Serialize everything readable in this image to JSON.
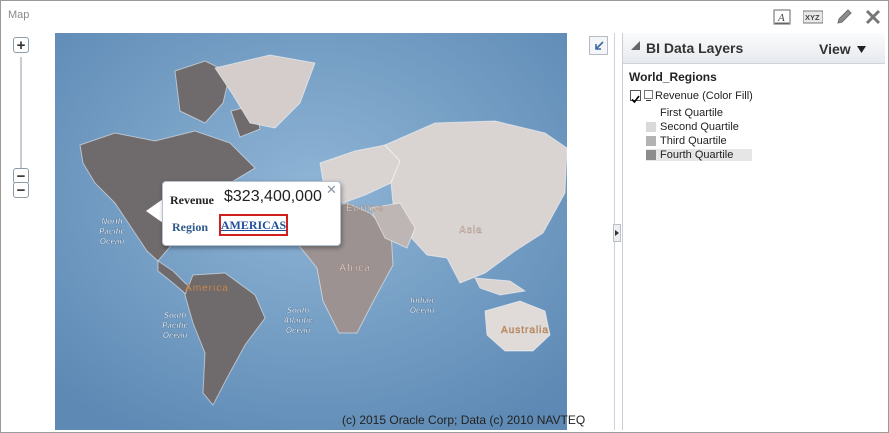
{
  "window": {
    "title": "Map"
  },
  "toolbar": {
    "format_text_label": "A",
    "xyz_label": "XYZ"
  },
  "map": {
    "copyright": "(c) 2015 Oracle Corp; Data (c) 2010 NAVTEQ",
    "labels": {
      "north_pacific": "North\nPacific\nOcean",
      "south_pacific": "South\nPacific\nOcean",
      "south_atlantic": "South\nAtlantic\nOcean",
      "indian": "Indian\nOcean",
      "europe": "Europe",
      "asia": "Asia",
      "africa": "Africa",
      "america": "America",
      "australia": "Australia"
    }
  },
  "tooltip": {
    "revenue_label": "Revenue",
    "revenue_value": "$323,400,000",
    "region_label": "Region",
    "region_value": "AMERICAS"
  },
  "panel": {
    "title": "BI Data Layers",
    "view_label": "View",
    "layer_group": "World_Regions",
    "layer_name": "Revenue (Color Fill)",
    "legend": [
      {
        "label": "First Quartile",
        "color": "#ffffff"
      },
      {
        "label": "Second Quartile",
        "color": "#d9d9d9"
      },
      {
        "label": "Third Quartile",
        "color": "#b3b3b3"
      },
      {
        "label": "Fourth Quartile",
        "color": "#8c8c8c"
      }
    ]
  },
  "colors": {
    "ocean": "#7fa6c8",
    "link": "#1f4f9a",
    "highlight_border": "#d01f1f"
  }
}
